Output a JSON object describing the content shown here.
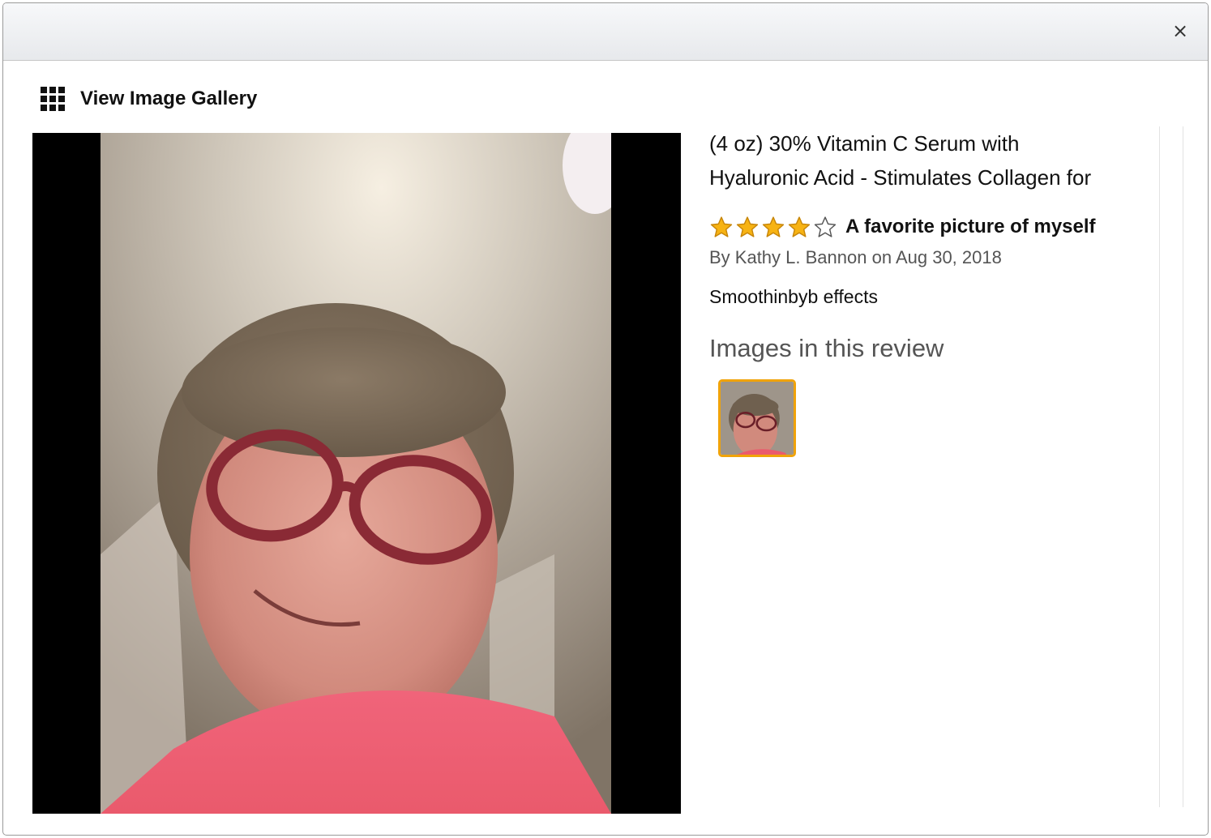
{
  "modal": {
    "close_label": "×",
    "gallery_label": "View Image Gallery"
  },
  "product": {
    "title_line1": "(4 oz) 30% Vitamin C Serum with",
    "title_line2": "Hyaluronic Acid - Stimulates Collagen for"
  },
  "review": {
    "rating": 4,
    "max_rating": 5,
    "title": "A favorite picture of myself",
    "byline": "By Kathy L. Bannon on Aug 30, 2018",
    "body": "Smoothinbyb effects",
    "images_heading": "Images in this review",
    "image_count": 1
  },
  "colors": {
    "star_fill": "#f7b313",
    "star_stroke": "#c7860a",
    "thumb_border": "#f0a30a"
  }
}
